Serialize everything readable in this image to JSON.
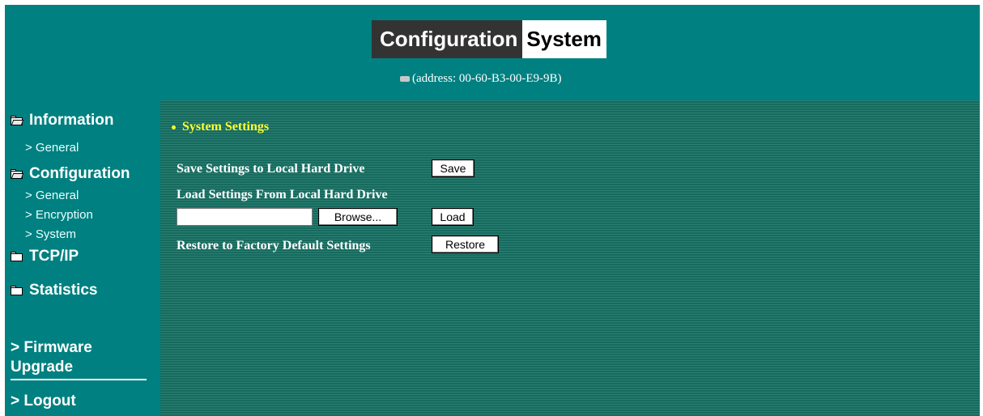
{
  "header": {
    "title_part1": "Configuration",
    "title_part2": "System",
    "address_text": "(address: 00-60-B3-00-E9-9B)",
    "address_icon": "network-card-icon"
  },
  "sidebar": {
    "information": {
      "label": "Information",
      "items": [
        {
          "label": "> General"
        }
      ]
    },
    "configuration": {
      "label": "Configuration",
      "items": [
        {
          "label": "> General"
        },
        {
          "label": "> Encryption"
        },
        {
          "label": "> System"
        }
      ]
    },
    "tcpip": {
      "label": "TCP/IP"
    },
    "statistics": {
      "label": "Statistics"
    },
    "firmware_line1": "> Firmware",
    "firmware_line2": "Upgrade",
    "logout": "> Logout"
  },
  "main": {
    "section_heading": "System Settings",
    "save_label": "Save Settings to Local Hard Drive",
    "save_button": "Save",
    "load_label": "Load Settings From Local Hard Drive",
    "file_value": "",
    "browse_button": "Browse...",
    "load_button": "Load",
    "restore_label": "Restore to Factory Default Settings",
    "restore_button": "Restore"
  },
  "colors": {
    "background": "#008080",
    "content_background": "#1f7266",
    "heading": "#ffff33"
  }
}
